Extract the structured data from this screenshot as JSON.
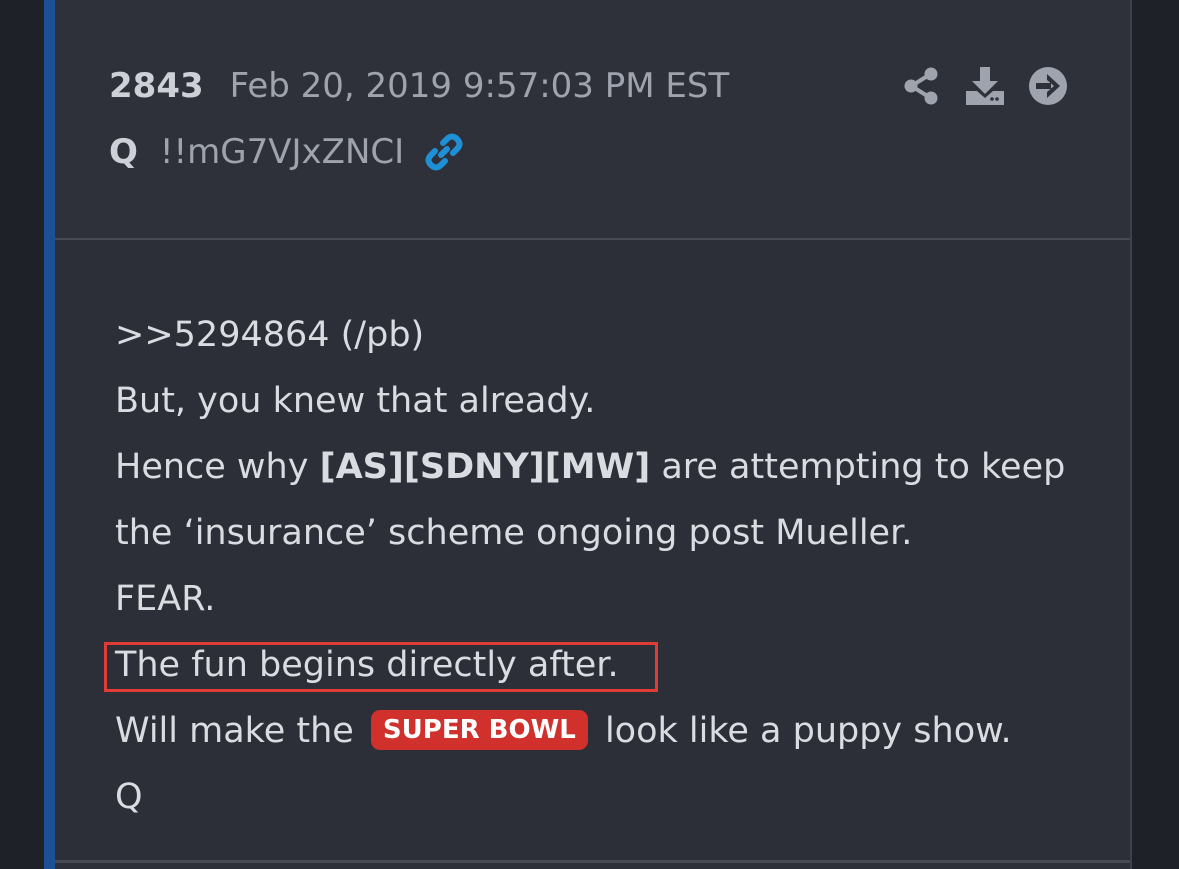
{
  "post": {
    "number": "2843",
    "date": "Feb 20, 2019 9:57:03 PM EST",
    "author": "Q",
    "tripcode": "!!mG7VJxZNCI",
    "link_icon": "link-icon",
    "actions": [
      {
        "icon": "share-icon"
      },
      {
        "icon": "download-icon"
      },
      {
        "icon": "arrow-right-circle-icon"
      }
    ]
  },
  "body": {
    "line1": ">>5294864 (/pb)",
    "line2": "But, you knew that already.",
    "line3_prefix": "Hence why ",
    "line3_bold": "[AS][SDNY][MW]",
    "line3_suffix": " are attempting to keep",
    "line4": "the ‘insurance’ scheme ongoing post Mueller.",
    "line5": "FEAR.",
    "line6": "The fun begins directly after.",
    "line7_prefix": "Will make the ",
    "line7_badge": "SUPER BOWL",
    "line7_suffix": " look like a puppy show.",
    "line8": "Q"
  },
  "colors": {
    "accent_bar": "#1d4f94",
    "highlight": "#e03b35",
    "badge": "#d0312d",
    "link": "#1f8fd6"
  }
}
